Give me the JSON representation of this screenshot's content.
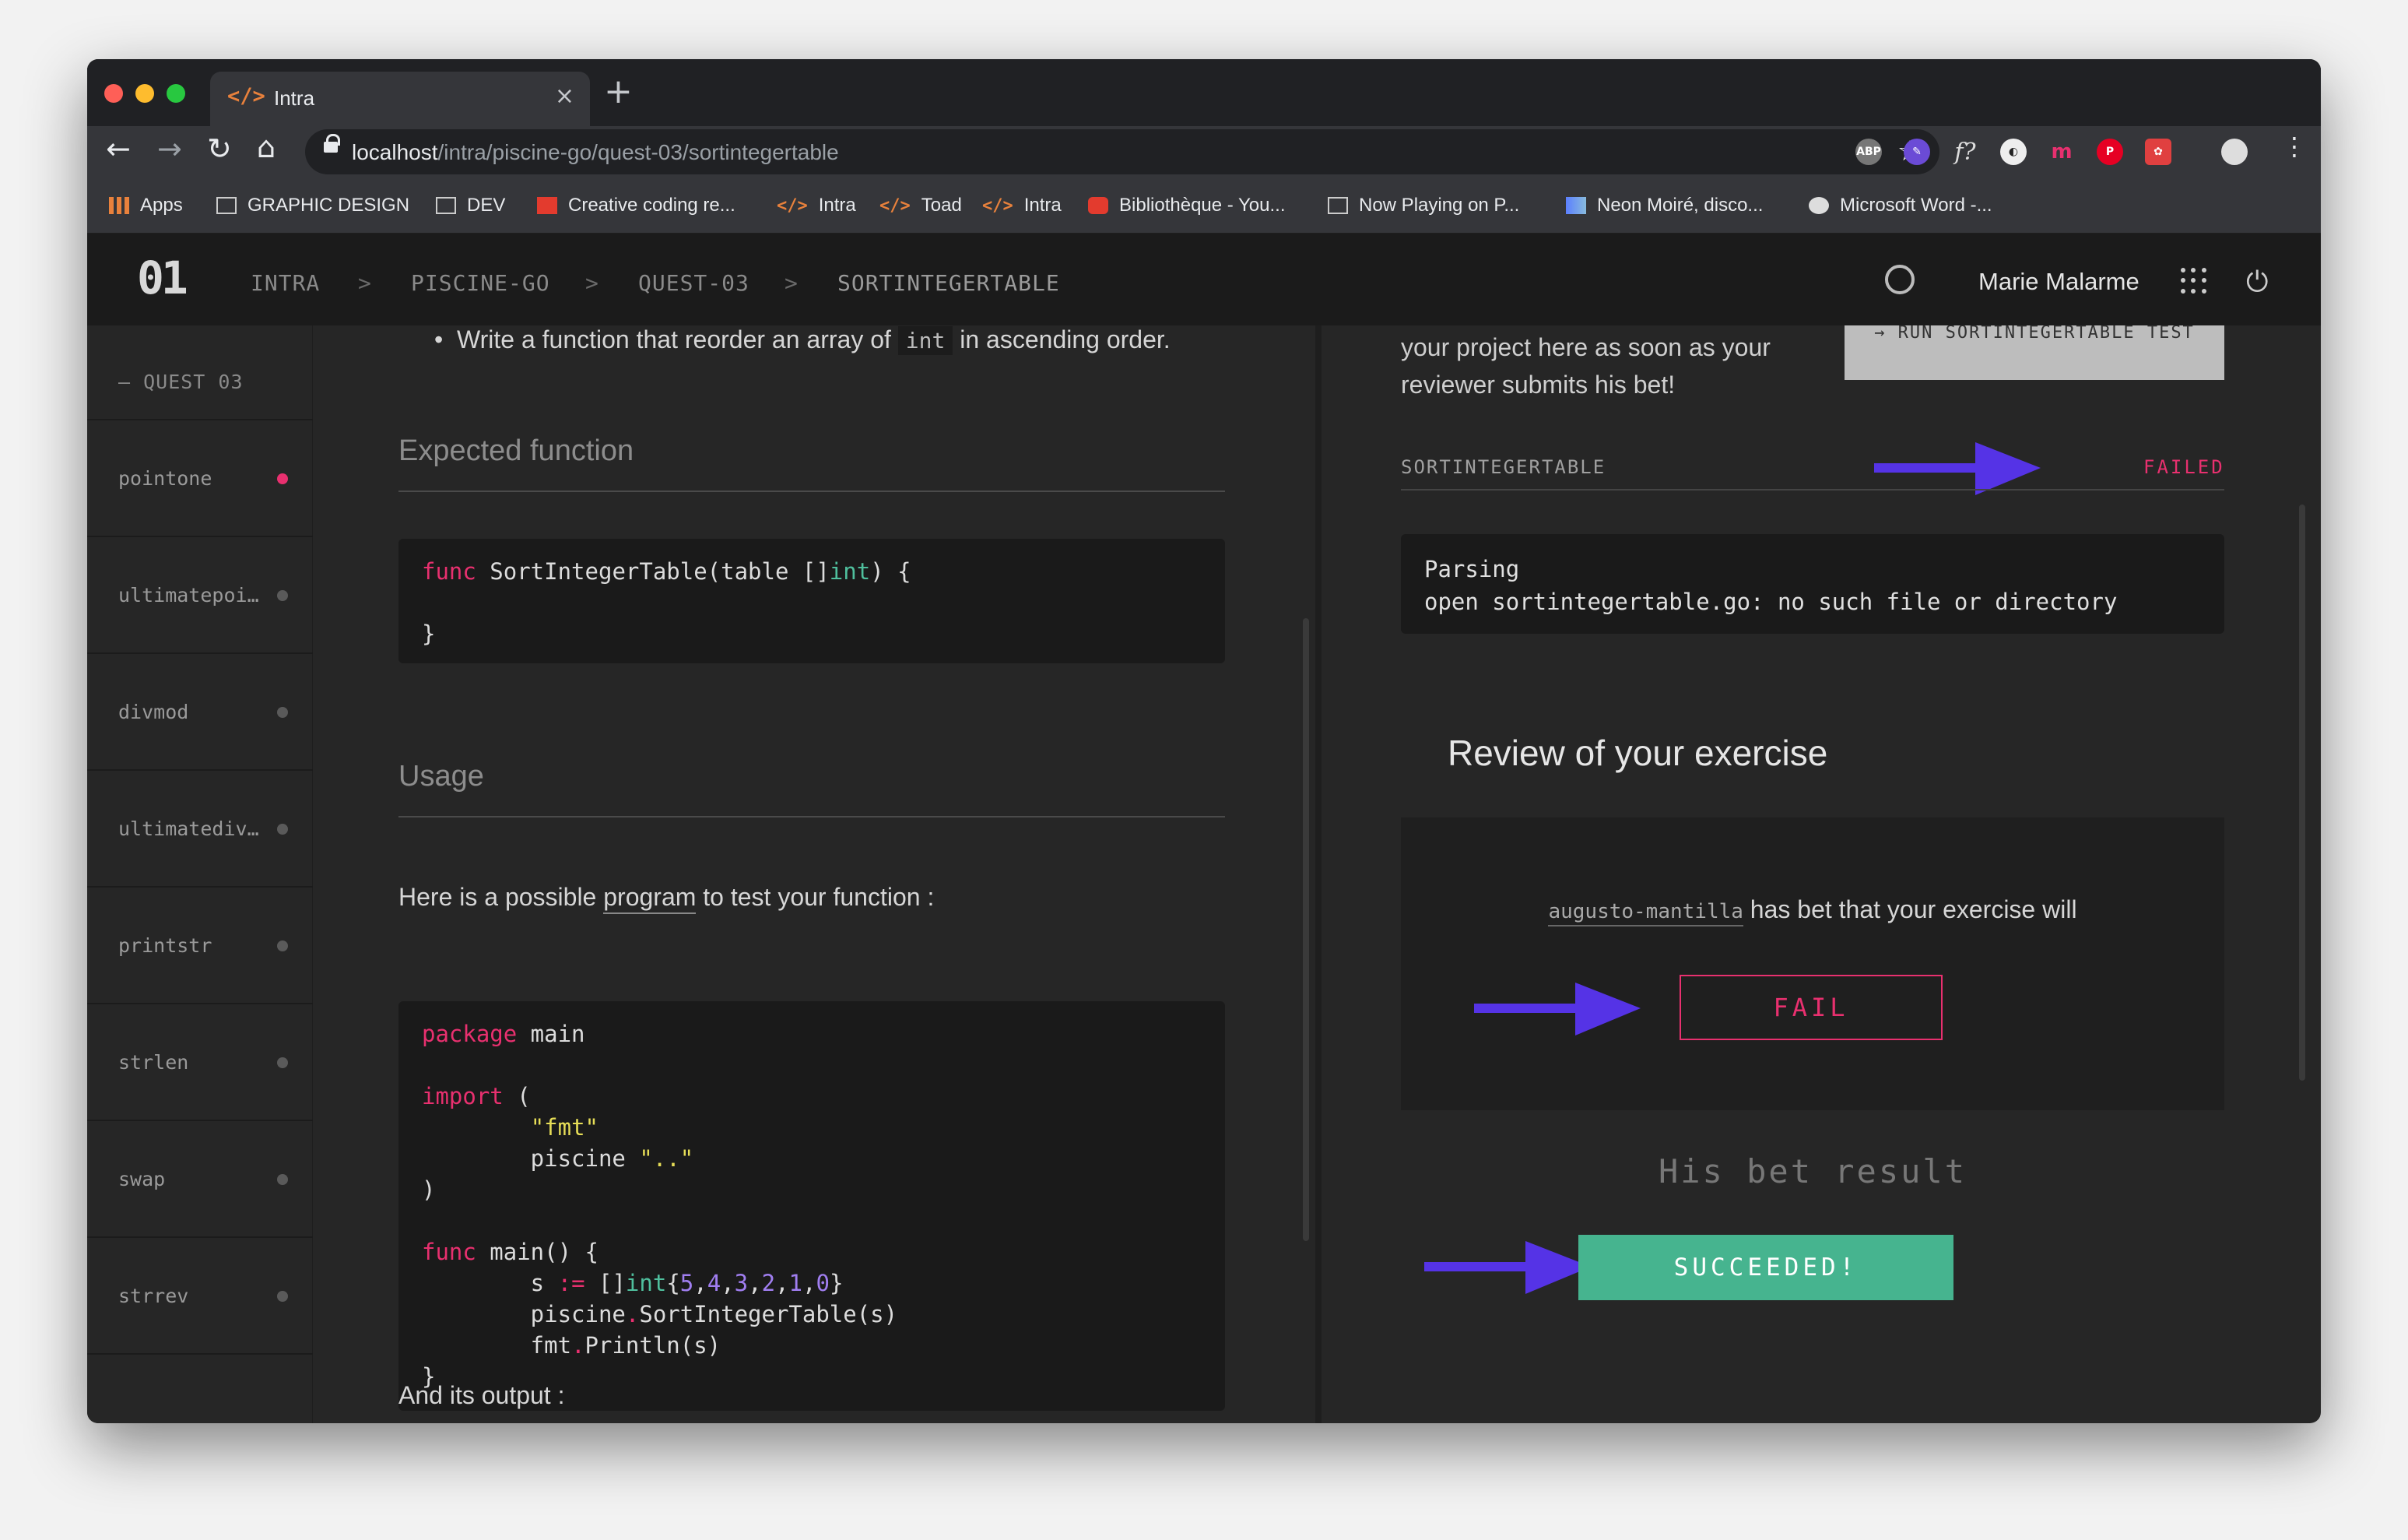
{
  "browser": {
    "tab_title": "Intra",
    "tab_icon": "</>",
    "url_host": "localhost",
    "url_path": "/intra/piscine-go/quest-03/sortintegertable",
    "bookmarks": [
      "Apps",
      "GRAPHIC DESIGN",
      "DEV",
      "Creative coding re...",
      "Intra",
      "Toad",
      "Intra",
      "Bibliothèque - You...",
      "Now Playing on P...",
      "Neon Moiré, disco...",
      "Microsoft Word -..."
    ]
  },
  "header": {
    "logo": "01",
    "breadcrumb": [
      "INTRA",
      "PISCINE-GO",
      "QUEST-03",
      "SORTINTEGERTABLE"
    ],
    "separator": ">",
    "user_name": "Marie Malarme"
  },
  "sidebar": {
    "heading": "— QUEST 03",
    "items": [
      {
        "label": "pointone",
        "status_color": "#e8306f"
      },
      {
        "label": "ultimatepoi…",
        "status_color": "#5a5a5a"
      },
      {
        "label": "divmod",
        "status_color": "#5a5a5a"
      },
      {
        "label": "ultimatediv…",
        "status_color": "#5a5a5a"
      },
      {
        "label": "printstr",
        "status_color": "#5a5a5a"
      },
      {
        "label": "strlen",
        "status_color": "#5a5a5a"
      },
      {
        "label": "swap",
        "status_color": "#5a5a5a"
      },
      {
        "label": "strrev",
        "status_color": "#5a5a5a"
      }
    ]
  },
  "main": {
    "instruction_pre": "Write a function that reorder an array of ",
    "instruction_code": "int",
    "instruction_post": " in ascending order.",
    "expected_heading": "Expected function",
    "usage_heading": "Usage",
    "usage_pre": "Here is a possible ",
    "usage_link": "program",
    "usage_post": " to test your function :",
    "output_label": "And its output :"
  },
  "review_panel": {
    "intro_text": "your project here as soon as your reviewer submits his bet!",
    "run_button": "→ RUN SORTINTEGERTABLE TEST",
    "exercise_label": "SORTINTEGERTABLE",
    "status": "FAILED",
    "error_line1": "Parsing",
    "error_line2": "open sortintegertable.go: no such file or directory",
    "review_title": "Review of your exercise",
    "reviewer_login": "augusto-mantilla",
    "bet_text": " has bet that your exercise will",
    "bet_value": "FAIL",
    "result_heading": "His bet result",
    "result_value": "SUCCEEDED!"
  },
  "colors": {
    "accent_pink": "#e8306f",
    "success_green": "#46b48f",
    "annotation_arrow": "#5533e6"
  }
}
